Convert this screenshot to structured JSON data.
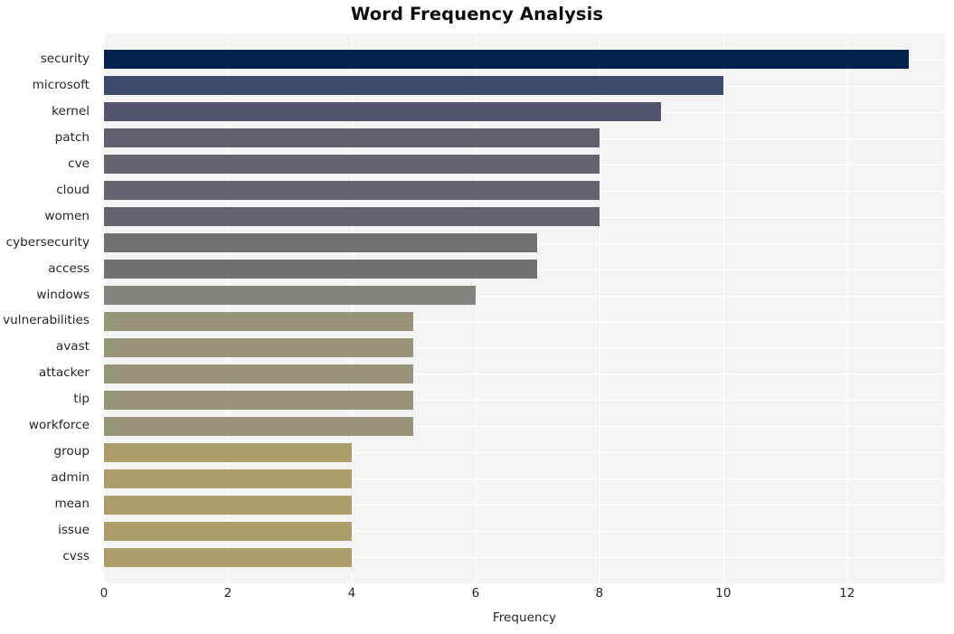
{
  "chart_data": {
    "type": "bar",
    "orientation": "horizontal",
    "title": "Word Frequency Analysis",
    "xlabel": "Frequency",
    "ylabel": "",
    "categories": [
      "security",
      "microsoft",
      "kernel",
      "patch",
      "cve",
      "cloud",
      "women",
      "cybersecurity",
      "access",
      "windows",
      "vulnerabilities",
      "avast",
      "attacker",
      "tip",
      "workforce",
      "group",
      "admin",
      "mean",
      "issue",
      "cvss"
    ],
    "values": [
      13,
      10,
      9,
      8,
      8,
      8,
      8,
      7,
      7,
      6,
      5,
      5,
      5,
      5,
      5,
      4,
      4,
      4,
      4,
      4
    ],
    "bar_colors": [
      "#04234f",
      "#3f4b6e",
      "#50546d",
      "#5f6170",
      "#62646f",
      "#62646f",
      "#62646f",
      "#717172",
      "#717172",
      "#85847c",
      "#98947a",
      "#98947a",
      "#98947a",
      "#98947a",
      "#98947a",
      "#ab9e69",
      "#ab9e69",
      "#ab9e69",
      "#ab9e69",
      "#ab9e69"
    ],
    "xticks": [
      "0",
      "2",
      "4",
      "6",
      "8",
      "10",
      "12"
    ],
    "xtick_values": [
      0,
      2,
      4,
      6,
      8,
      10,
      12
    ],
    "xlim": [
      0,
      13.58
    ],
    "grid": true,
    "grid_color": "#ffffff",
    "plot_background": "#f4f4f5",
    "figure_background": "#ffffff",
    "legend": null
  }
}
